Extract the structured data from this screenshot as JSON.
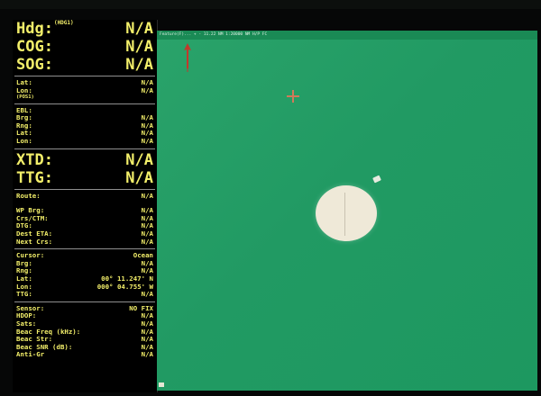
{
  "nav": {
    "hdg_label": "Hdg:",
    "hdg_sup": "(HDG1)",
    "hdg_value": "N/A",
    "cog_label": "COG:",
    "cog_value": "N/A",
    "sog_label": "SOG:",
    "sog_value": "N/A"
  },
  "position": {
    "lat_label": "Lat:",
    "lat_value": "N/A",
    "lon_label": "Lon:",
    "lon_value": "N/A",
    "source": "(POS1)"
  },
  "ebl": {
    "title": "EBL:",
    "brg_label": "Brg:",
    "brg_value": "N/A",
    "rng_label": "Rng:",
    "rng_value": "N/A",
    "lat_label": "Lat:",
    "lat_value": "N/A",
    "lon_label": "Lon:",
    "lon_value": "N/A"
  },
  "xtd": {
    "label": "XTD:",
    "value": "N/A"
  },
  "ttg": {
    "label": "TTG:",
    "value": "N/A"
  },
  "route": {
    "label": "Route:",
    "value": "N/A",
    "wp_brg_label": "WP Brg:",
    "wp_brg_value": "N/A",
    "crs_ctm_label": "Crs/CTM:",
    "crs_ctm_value": "N/A",
    "dtg_label": "DTG:",
    "dtg_value": "N/A",
    "dest_eta_label": "Dest ETA:",
    "dest_eta_value": "N/A",
    "next_crs_label": "Next Crs:",
    "next_crs_value": "N/A"
  },
  "cursor": {
    "label": "Cursor:",
    "value": "Ocean",
    "brg_label": "Brg:",
    "brg_value": "N/A",
    "rng_label": "Rng:",
    "rng_value": "N/A",
    "lat_label": "Lat:",
    "lat_value": "00° 11.247' N",
    "lon_label": "Lon:",
    "lon_value": "000° 04.755' W",
    "ttg_label": "TTG:",
    "ttg_value": "N/A"
  },
  "sensor": {
    "label": "Sensor:",
    "value": "NO FIX",
    "hdop_label": "HDOP:",
    "hdop_value": "N/A",
    "sats_label": "Sats:",
    "sats_value": "N/A",
    "beac_freq_label": "Beac Freq (kHz):",
    "beac_freq_value": "N/A",
    "beac_str_label": "Beac Str:",
    "beac_str_value": "N/A",
    "beac_snr_label": "Beac SNR (dB):",
    "beac_snr_value": "N/A",
    "anti_gr_label": "Anti-Gr",
    "anti_gr_value": "N/A"
  },
  "chart": {
    "toolbar_text": "Feature(F)...  +  -  11.22 NM  1:20000  NM  H/P  FC",
    "status_text": ""
  },
  "colors": {
    "panel_text": "#f3ef6a",
    "chart_water": "#219a63",
    "cursor_mark": "#d07a5a"
  }
}
